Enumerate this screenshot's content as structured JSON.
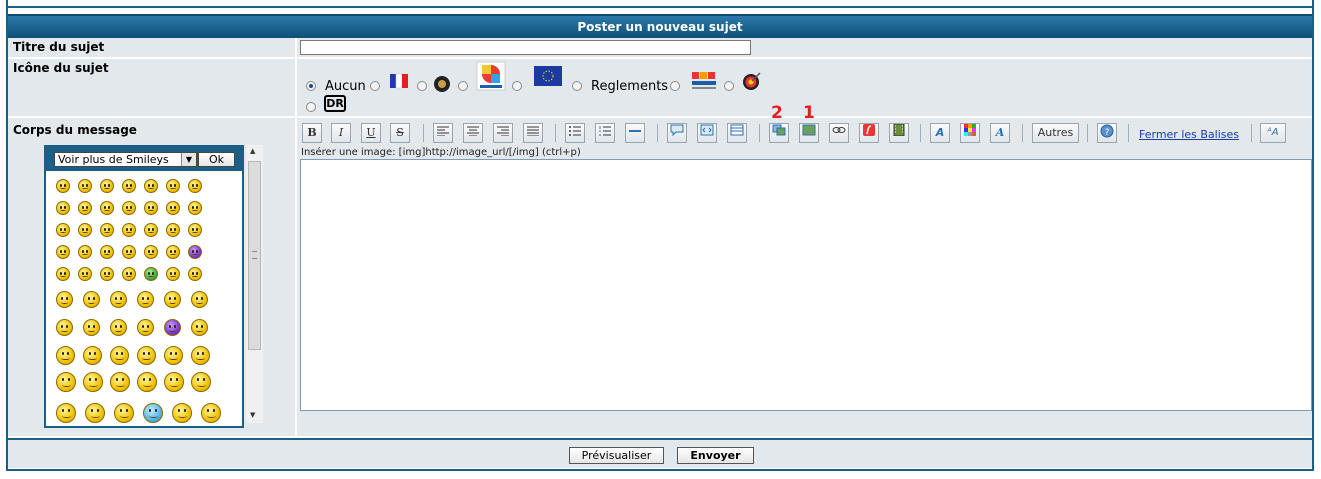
{
  "header": {
    "title": "Poster un nouveau sujet"
  },
  "fields": {
    "subject_label": "Titre du sujet",
    "icon_label": "Icône du sujet",
    "body_label": "Corps du message",
    "subject_value": ""
  },
  "icons": {
    "none_label": "Aucun",
    "rules_label": "Reglements",
    "dr_label": "DR",
    "items": [
      "none",
      "france-flag",
      "disc",
      "world-archery",
      "eu-flag",
      "rules",
      "archery-cup",
      "target"
    ]
  },
  "toolbar": {
    "bold": "B",
    "italic": "I",
    "underline": "U",
    "strike": "S",
    "others_label": "Autres",
    "close_tags_label": "Fermer les Balises",
    "hint": "Insérer une image: [img]http://image_url/[/img] (ctrl+p)",
    "annotation_2": "2",
    "annotation_1": "1"
  },
  "smileys": {
    "select_label": "Voir plus de Smileys",
    "ok_label": "Ok"
  },
  "footer": {
    "preview_label": "Prévisualiser",
    "submit_label": "Envoyer"
  },
  "colors": {
    "header": "#1b5f86",
    "row_bg": "#e3e8ec",
    "annotation": "#e02020"
  }
}
